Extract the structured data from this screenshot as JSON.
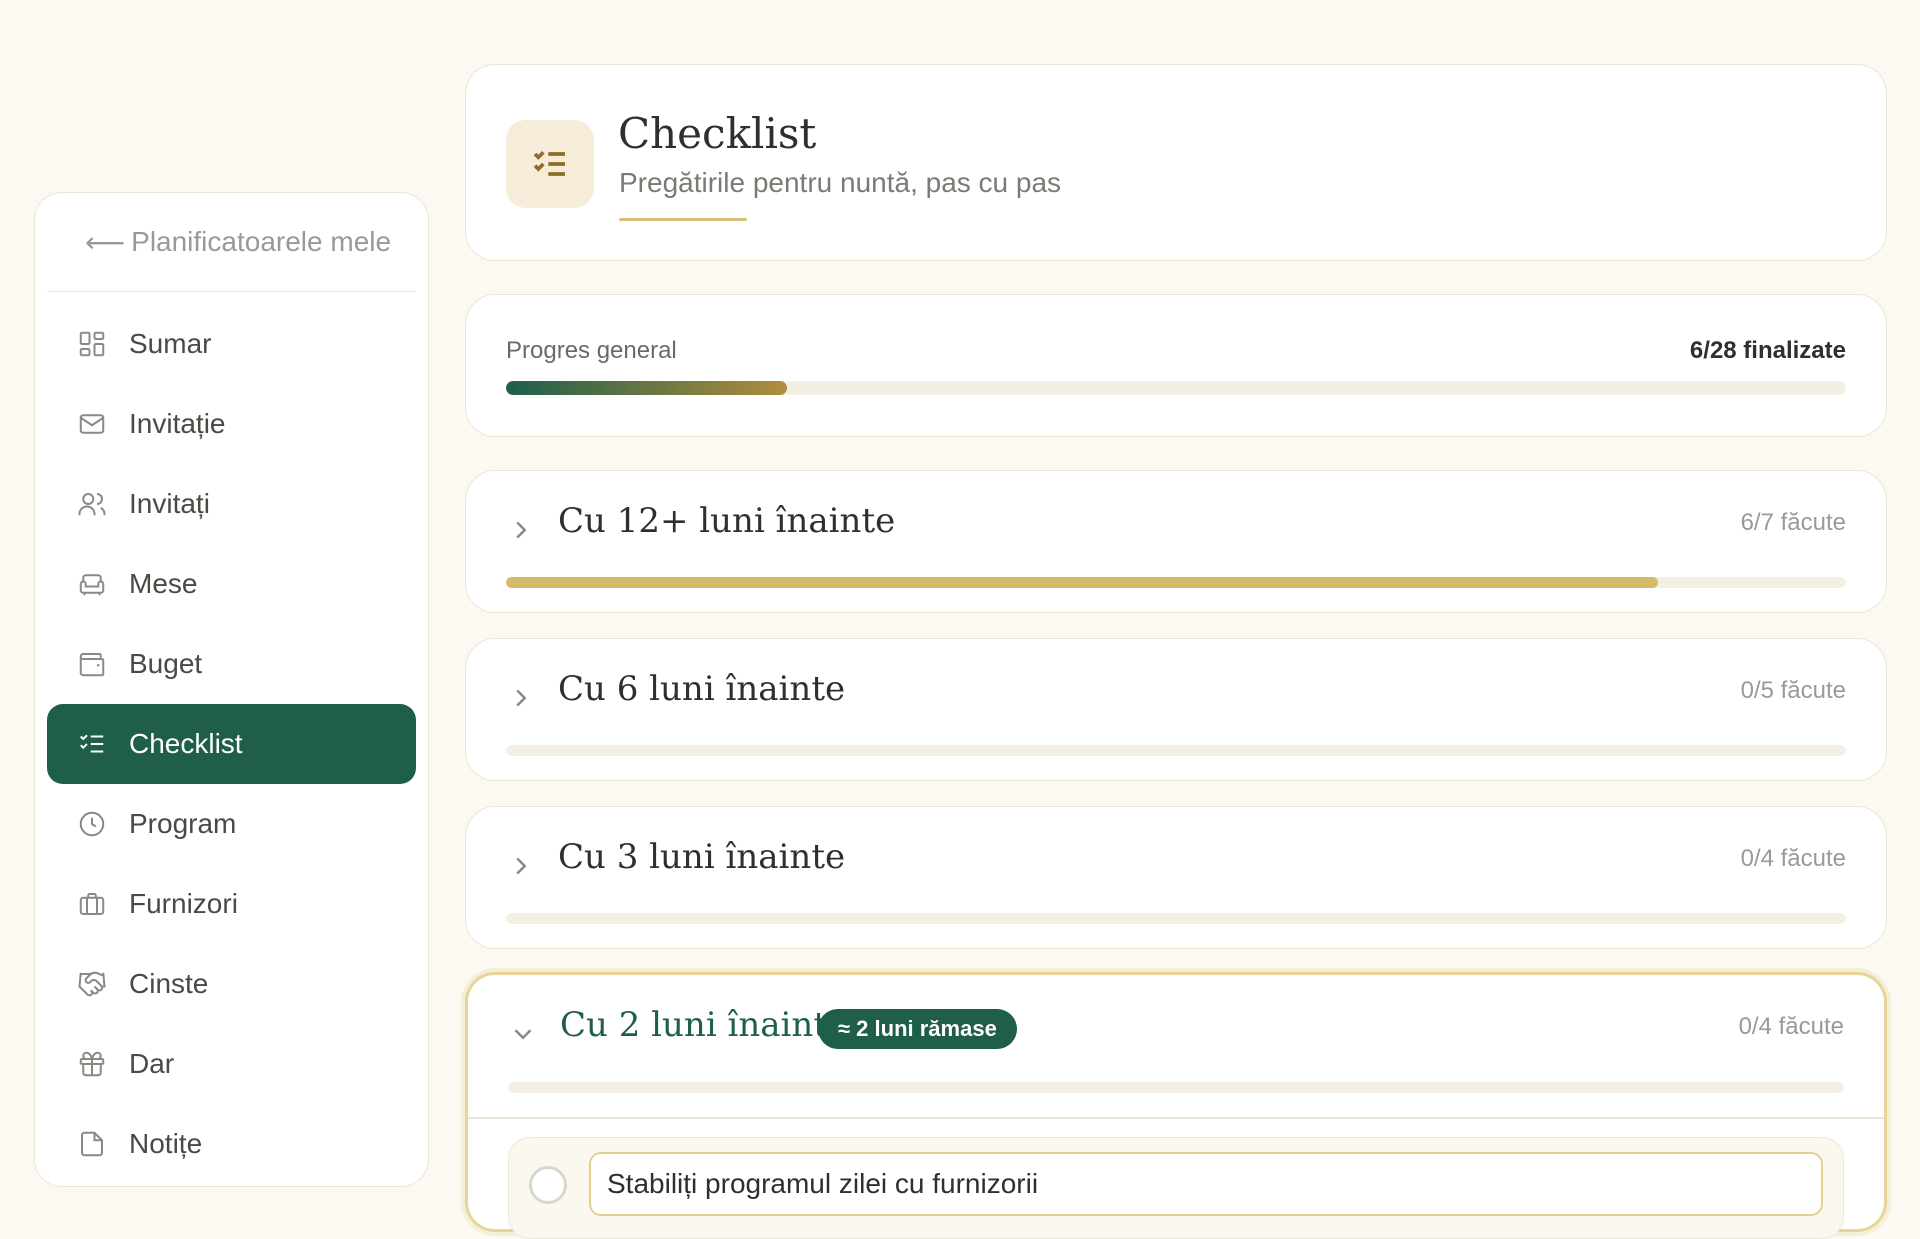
{
  "sidebar": {
    "back_label": "Planificatoarele mele",
    "items": [
      {
        "label": "Sumar",
        "icon": "dashboard-icon"
      },
      {
        "label": "Invitație",
        "icon": "envelope-icon"
      },
      {
        "label": "Invitați",
        "icon": "users-icon"
      },
      {
        "label": "Mese",
        "icon": "sofa-icon"
      },
      {
        "label": "Buget",
        "icon": "wallet-icon"
      },
      {
        "label": "Checklist",
        "icon": "checklist-icon",
        "active": true
      },
      {
        "label": "Program",
        "icon": "clock-icon"
      },
      {
        "label": "Furnizori",
        "icon": "briefcase-icon"
      },
      {
        "label": "Cinste",
        "icon": "handshake-icon"
      },
      {
        "label": "Dar",
        "icon": "gift-icon"
      },
      {
        "label": "Notițe",
        "icon": "note-icon"
      }
    ]
  },
  "header": {
    "title": "Checklist",
    "subtitle": "Pregătirile pentru nuntă, pas cu pas",
    "icon": "checklist-icon"
  },
  "progress": {
    "label": "Progres general",
    "count": "6/28 finalizate",
    "fraction": 0.21
  },
  "sections": [
    {
      "title": "Cu 12+ luni înainte",
      "count": "6/7 făcute",
      "fraction": 0.86,
      "expanded": false
    },
    {
      "title": "Cu 6 luni înainte",
      "count": "0/5 făcute",
      "fraction": 0,
      "expanded": false
    },
    {
      "title": "Cu 3 luni înainte",
      "count": "0/4 făcute",
      "fraction": 0,
      "expanded": false
    },
    {
      "title": "Cu 2 luni înainte",
      "count": "0/4 făcute",
      "fraction": 0,
      "expanded": true,
      "badge": "≈ 2 luni rămase"
    }
  ],
  "tasks": [
    {
      "text": "Stabiliți programul zilei cu furnizorii",
      "done": false
    }
  ],
  "colors": {
    "accent_green": "#1e5e4b",
    "accent_gold": "#d6ba6c",
    "background": "#fbf9f2"
  }
}
